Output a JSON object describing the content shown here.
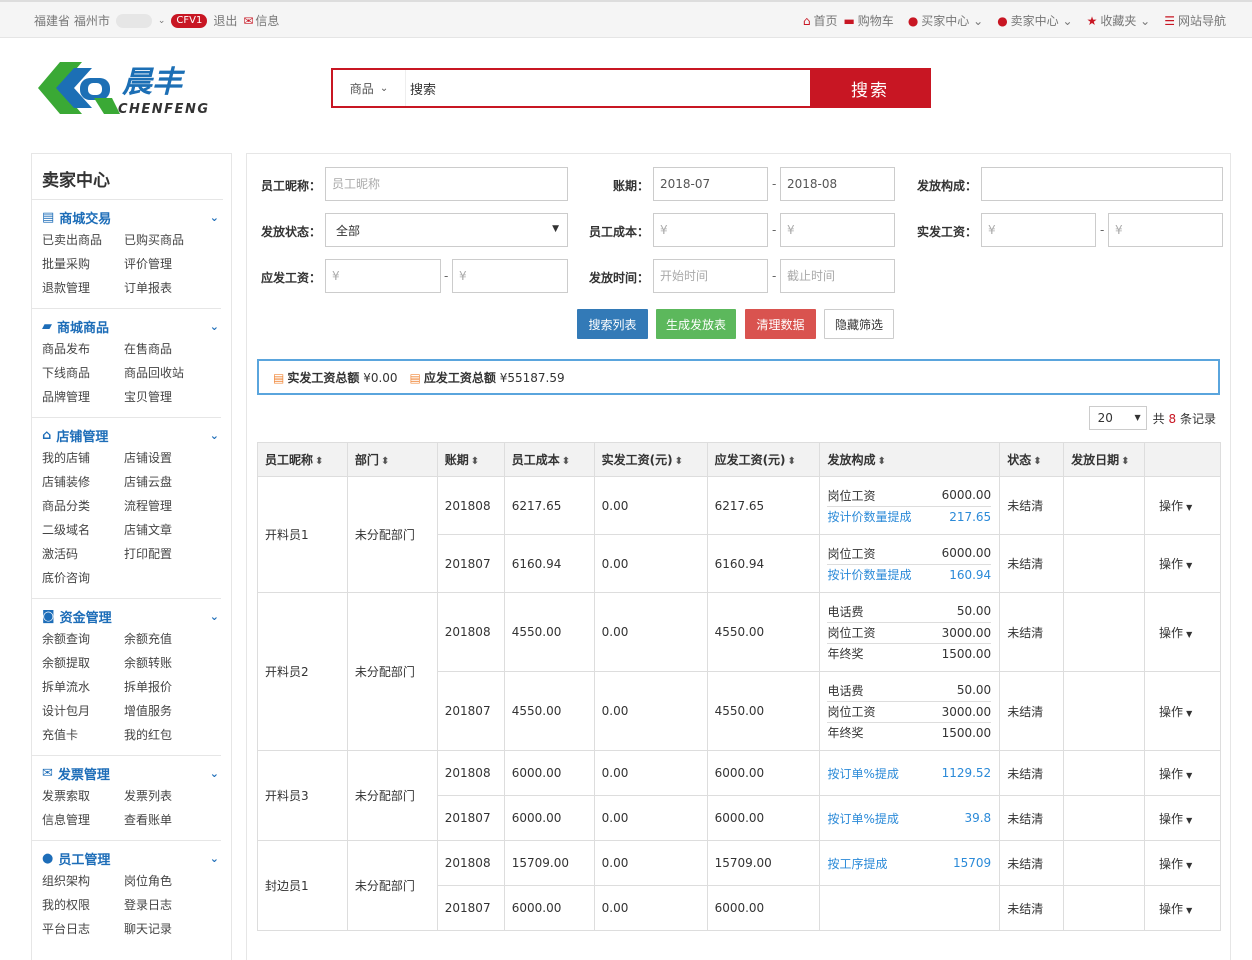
{
  "topbar": {
    "location": "福建省 福州市",
    "badge": "CFV1",
    "logout": "退出",
    "message": "信息",
    "links": [
      {
        "label": "首页",
        "icon": "home-icon"
      },
      {
        "label": "购物车",
        "icon": "cart-icon"
      },
      {
        "label": "买家中心",
        "icon": "user-icon"
      },
      {
        "label": "卖家中心",
        "icon": "user-icon"
      },
      {
        "label": "收藏夹",
        "icon": "star-icon"
      },
      {
        "label": "网站导航",
        "icon": "list-icon"
      }
    ]
  },
  "brand": {
    "name_cn": "晨丰",
    "name_en": "CHENFENG"
  },
  "search": {
    "category": "商品",
    "value": "搜索",
    "button": "搜索"
  },
  "sidebar": {
    "title": "卖家中心",
    "sections": [
      {
        "title": "商城交易",
        "icon": "list-icon",
        "items": [
          "已卖出商品",
          "已购买商品",
          "批量采购",
          "评价管理",
          "退款管理",
          "订单报表"
        ]
      },
      {
        "title": "商城商品",
        "icon": "truck-icon",
        "items": [
          "商品发布",
          "在售商品",
          "下线商品",
          "商品回收站",
          "品牌管理",
          "宝贝管理"
        ]
      },
      {
        "title": "店铺管理",
        "icon": "home-icon",
        "items": [
          "我的店铺",
          "店铺设置",
          "店铺装修",
          "店铺云盘",
          "商品分类",
          "流程管理",
          "二级域名",
          "店铺文章",
          "激活码",
          "打印配置",
          "底价咨询"
        ]
      },
      {
        "title": "资金管理",
        "icon": "money-icon",
        "items": [
          "余额查询",
          "余额充值",
          "余额提取",
          "余额转账",
          "拆单流水",
          "拆单报价",
          "设计包月",
          "增值服务",
          "充值卡",
          "我的红包"
        ]
      },
      {
        "title": "发票管理",
        "icon": "envelope-icon",
        "items": [
          "发票索取",
          "发票列表",
          "信息管理",
          "查看账单"
        ]
      },
      {
        "title": "员工管理",
        "icon": "users-icon",
        "items": [
          "组织架构",
          "岗位角色",
          "我的权限",
          "登录日志",
          "平台日志",
          "聊天记录"
        ]
      }
    ]
  },
  "filters": {
    "nickname_label": "员工昵称：",
    "nickname_placeholder": "员工昵称",
    "period_label": "账期：",
    "period_from": "2018-07",
    "period_to": "2018-08",
    "composition_label": "发放构成：",
    "status_label": "发放状态：",
    "status_value": "全部",
    "cost_label": "员工成本：",
    "actual_label": "实发工资：",
    "due_label": "应发工资：",
    "time_label": "发放时间：",
    "start_placeholder": "开始时间",
    "end_placeholder": "截止时间",
    "yen_placeholder": "¥",
    "dash": "-"
  },
  "buttons": {
    "search": "搜索列表",
    "generate": "生成发放表",
    "clear": "清理数据",
    "hide": "隐藏筛选"
  },
  "summary": {
    "actual_label": "实发工资总额",
    "actual_value": "¥0.00",
    "due_label": "应发工资总额",
    "due_value": "¥55187.59"
  },
  "pager": {
    "page_size": "20",
    "prefix": "共",
    "count": "8",
    "suffix": "条记录"
  },
  "table": {
    "headers": [
      "员工昵称",
      "部门",
      "账期",
      "员工成本",
      "实发工资(元)",
      "应发工资(元)",
      "发放构成",
      "状态",
      "发放日期"
    ],
    "op_label": "操作",
    "groups": [
      {
        "name": "开料员1",
        "dept": "未分配部门",
        "rows": [
          {
            "period": "201808",
            "cost": "6217.65",
            "actual": "0.00",
            "due": "6217.65",
            "status": "未结清",
            "comp": [
              {
                "name": "岗位工资",
                "value": "6000.00",
                "link": false
              },
              {
                "name": "按计价数量提成",
                "value": "217.65",
                "link": true
              }
            ]
          },
          {
            "period": "201807",
            "cost": "6160.94",
            "actual": "0.00",
            "due": "6160.94",
            "status": "未结清",
            "comp": [
              {
                "name": "岗位工资",
                "value": "6000.00",
                "link": false
              },
              {
                "name": "按计价数量提成",
                "value": "160.94",
                "link": true
              }
            ]
          }
        ]
      },
      {
        "name": "开料员2",
        "dept": "未分配部门",
        "rows": [
          {
            "period": "201808",
            "cost": "4550.00",
            "actual": "0.00",
            "due": "4550.00",
            "status": "未结清",
            "comp": [
              {
                "name": "电话费",
                "value": "50.00",
                "link": false
              },
              {
                "name": "岗位工资",
                "value": "3000.00",
                "link": false
              },
              {
                "name": "年终奖",
                "value": "1500.00",
                "link": false
              }
            ]
          },
          {
            "period": "201807",
            "cost": "4550.00",
            "actual": "0.00",
            "due": "4550.00",
            "status": "未结清",
            "comp": [
              {
                "name": "电话费",
                "value": "50.00",
                "link": false
              },
              {
                "name": "岗位工资",
                "value": "3000.00",
                "link": false
              },
              {
                "name": "年终奖",
                "value": "1500.00",
                "link": false
              }
            ]
          }
        ]
      },
      {
        "name": "开料员3",
        "dept": "未分配部门",
        "rows": [
          {
            "period": "201808",
            "cost": "6000.00",
            "actual": "0.00",
            "due": "6000.00",
            "status": "未结清",
            "comp": [
              {
                "name": "按订单%提成",
                "value": "1129.52",
                "link": true
              }
            ]
          },
          {
            "period": "201807",
            "cost": "6000.00",
            "actual": "0.00",
            "due": "6000.00",
            "status": "未结清",
            "comp": [
              {
                "name": "按订单%提成",
                "value": "39.8",
                "link": true
              }
            ]
          }
        ]
      },
      {
        "name": "封边员1",
        "dept": "未分配部门",
        "rows": [
          {
            "period": "201808",
            "cost": "15709.00",
            "actual": "0.00",
            "due": "15709.00",
            "status": "未结清",
            "comp": [
              {
                "name": "按工序提成",
                "value": "15709",
                "link": true
              }
            ]
          },
          {
            "period": "201807",
            "cost": "6000.00",
            "actual": "0.00",
            "due": "6000.00",
            "status": "未结清",
            "comp": []
          }
        ]
      }
    ]
  }
}
